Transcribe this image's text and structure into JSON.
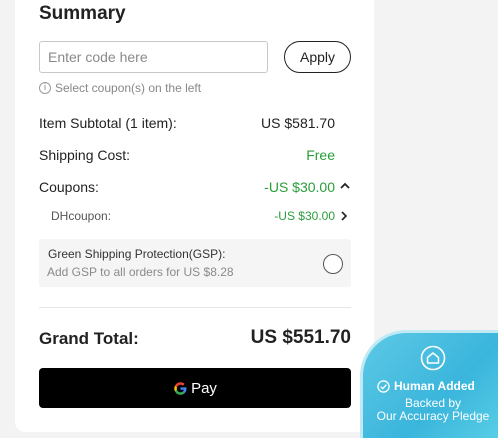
{
  "summary": {
    "title": "Summary",
    "coupon_input": {
      "placeholder": "Enter code here",
      "value": ""
    },
    "apply_label": "Apply",
    "hint": "Select coupon(s) on the left",
    "rows": {
      "subtotal": {
        "label": "Item Subtotal (1 item):",
        "value": "US $581.70"
      },
      "shipping": {
        "label": "Shipping Cost:",
        "value": "Free"
      },
      "coupons": {
        "label": "Coupons:",
        "value": "-US $30.00"
      },
      "dhcoupon": {
        "label": "DHcoupon:",
        "value": "-US $30.00"
      }
    },
    "gsp": {
      "title": "Green Shipping Protection(GSP):",
      "subtitle": "Add GSP to all orders for US $8.28",
      "checked": false
    },
    "grand_total": {
      "label": "Grand Total:",
      "value": "US $551.70"
    },
    "gpay_label": "Pay"
  },
  "badge": {
    "line1": "Human Added",
    "line2": "Backed by",
    "line3": "Our Accuracy Pledge"
  },
  "colors": {
    "accent_green": "#2a9d3a",
    "badge_blue": "#3ab5dc",
    "pay_button": "#000000"
  }
}
